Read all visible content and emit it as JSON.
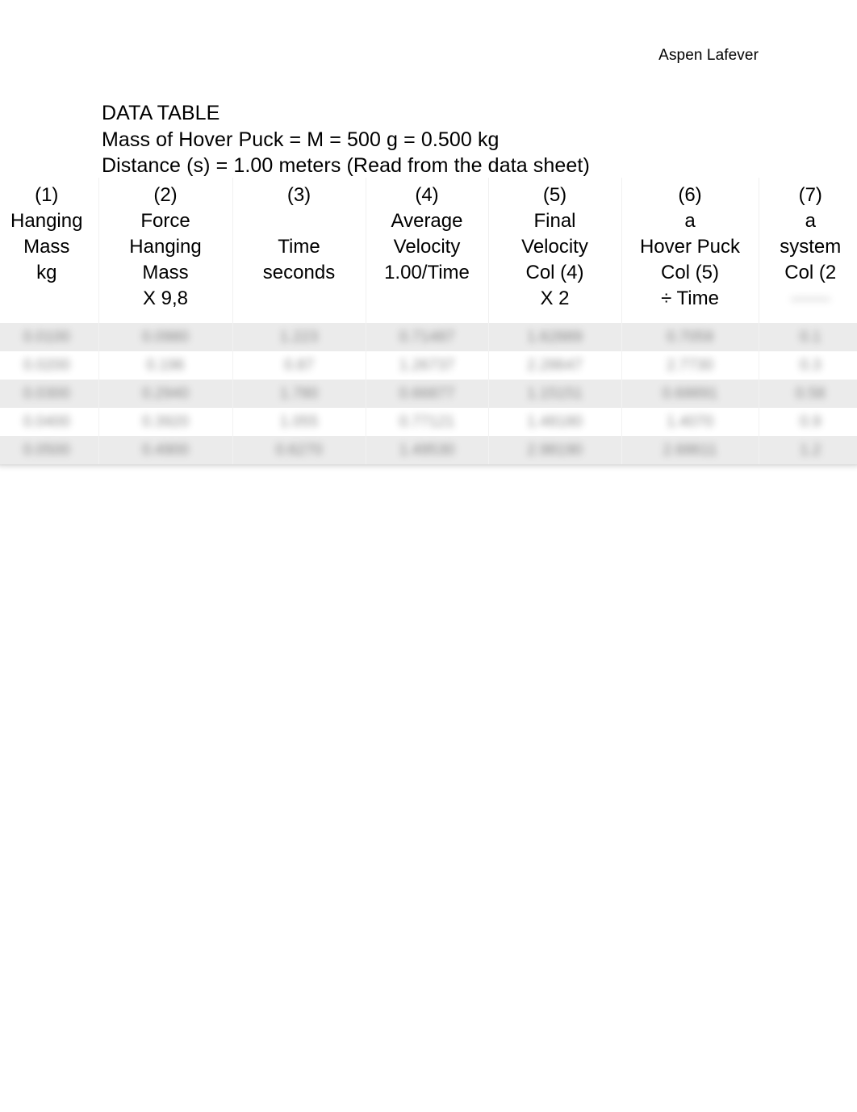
{
  "document": {
    "author_header": "Aspen Lafever",
    "intro_lines": [
      "DATA TABLE",
      "Mass of Hover Puck = M = 500 g = 0.500 kg",
      "Distance (s) = 1.00 meters (Read from the data sheet)"
    ]
  },
  "table": {
    "columns": [
      {
        "number": "(1)",
        "lines": [
          "(1)",
          "Hanging",
          "Mass",
          "kg",
          ""
        ]
      },
      {
        "number": "(2)",
        "lines": [
          "(2)",
          "Force",
          "Hanging",
          "Mass",
          "X 9,8"
        ]
      },
      {
        "number": "(3)",
        "lines": [
          "(3)",
          "",
          "Time",
          "seconds",
          ""
        ]
      },
      {
        "number": "(4)",
        "lines": [
          "(4)",
          "Average",
          "Velocity",
          "1.00/Time",
          ""
        ]
      },
      {
        "number": "(5)",
        "lines": [
          "(5)",
          "Final",
          "Velocity",
          "Col (4)",
          "X 2"
        ]
      },
      {
        "number": "(6)",
        "lines": [
          "(6)",
          "a",
          "Hover Puck",
          "Col (5)",
          "÷ Time"
        ]
      },
      {
        "number": "(7)",
        "lines": [
          "(7)",
          "a",
          "system",
          "Col (2",
          "——"
        ]
      }
    ],
    "rows": [
      {
        "shade": true,
        "cells": [
          "0.0100",
          "0.0980",
          "1.223",
          "0.71487",
          "1.62889",
          "0.7059",
          "0.1"
        ]
      },
      {
        "shade": false,
        "cells": [
          "0.0200",
          "0.196",
          "0.87",
          "1.26737",
          "2.28647",
          "2.7730",
          "0.3"
        ]
      },
      {
        "shade": true,
        "cells": [
          "0.0300",
          "0.2940",
          "1.780",
          "0.66877",
          "1.15151",
          "0.68891",
          "0.58"
        ]
      },
      {
        "shade": false,
        "cells": [
          "0.0400",
          "0.3920",
          "1.055",
          "0.77121",
          "1.48180",
          "1.4070",
          "0.9"
        ]
      },
      {
        "shade": true,
        "cells": [
          "0.0500",
          "0.4900",
          "0.6270",
          "1.49530",
          "2.98190",
          "2.68611",
          "1.2"
        ]
      }
    ]
  }
}
